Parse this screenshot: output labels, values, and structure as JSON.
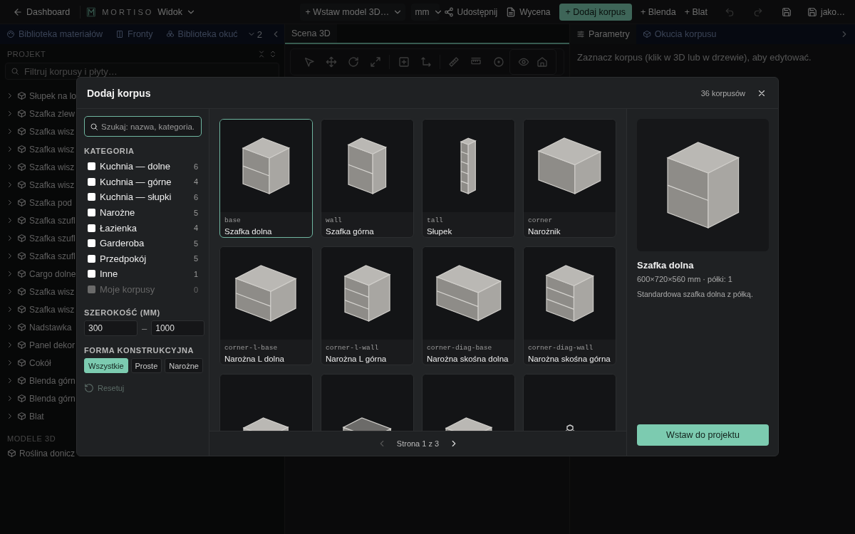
{
  "topbar": {
    "back": "Dashboard",
    "logo": "MORTISO",
    "view_menu": "Widok",
    "insert_model": "+ Wstaw model 3D…",
    "unit": "mm",
    "share": "Udostępnij",
    "quote": "Wycena",
    "add_cabinet": "+ Dodaj korpus",
    "add_blend": "+ Blenda",
    "add_top": "+ Blat",
    "save_as": "jako…"
  },
  "left_panel": {
    "tabs": [
      {
        "label": "Biblioteka materiałów",
        "selected": false
      },
      {
        "label": "Fronty",
        "selected": false
      },
      {
        "label": "Biblioteka okuć",
        "selected": false
      }
    ],
    "overflow": "2",
    "section": "PROJEKT",
    "filter": {
      "placeholder": "Filtruj korpusy i płyty…"
    },
    "tree": [
      {
        "label": "Słupek na lo",
        "expanded": false
      },
      {
        "label": "Szafka zlew",
        "expanded": false
      },
      {
        "label": "Szafka wisz",
        "expanded": false
      },
      {
        "label": "Szafka wisz",
        "expanded": false
      },
      {
        "label": "Szafka wisz",
        "expanded": false
      },
      {
        "label": "Szafka wisz",
        "expanded": false
      },
      {
        "label": "Szafka pod",
        "expanded": false
      },
      {
        "label": "Szafka szufl",
        "expanded": false
      },
      {
        "label": "Szafka szufl",
        "expanded": false
      },
      {
        "label": "Szafka szufl",
        "expanded": false
      },
      {
        "label": "Cargo dolne",
        "expanded": false
      },
      {
        "label": "Szafka wisz",
        "expanded": false
      },
      {
        "label": "Szafka wisz",
        "expanded": false
      },
      {
        "label": "Nadstawka",
        "expanded": false
      },
      {
        "label": "Panel dekor",
        "expanded": false
      },
      {
        "label": "Cokół",
        "expanded": false
      },
      {
        "label": "Blenda górn",
        "expanded": false
      },
      {
        "label": "Blenda górn",
        "expanded": false
      },
      {
        "label": "Blat",
        "expanded": false
      }
    ],
    "models_section": "MODELE 3D",
    "models": [
      {
        "label": "Roślina donicz"
      }
    ]
  },
  "center_panel": {
    "tabs": [
      {
        "label": "Scena 3D",
        "selected": true
      }
    ]
  },
  "right_panel": {
    "tabs": [
      {
        "label": "Parametry",
        "selected": true
      },
      {
        "label": "Okucia korpusu",
        "selected": false
      }
    ],
    "hint": "Zaznacz korpus (klik w 3D lub w drzewie), aby edytować."
  },
  "dialog": {
    "title": "Dodaj korpus",
    "count": "36 korpusów",
    "search": {
      "placeholder": "Szukaj: nazwa, kategoria."
    },
    "category_heading": "KATEGORIA",
    "categories": [
      {
        "label": "Kuchnia — dolne",
        "count": "6",
        "checked": false,
        "disabled": false
      },
      {
        "label": "Kuchnia — górne",
        "count": "4",
        "checked": false,
        "disabled": false
      },
      {
        "label": "Kuchnia — słupki",
        "count": "6",
        "checked": false,
        "disabled": false
      },
      {
        "label": "Narożne",
        "count": "5",
        "checked": false,
        "disabled": false
      },
      {
        "label": "Łazienka",
        "count": "4",
        "checked": false,
        "disabled": false
      },
      {
        "label": "Garderoba",
        "count": "5",
        "checked": false,
        "disabled": false
      },
      {
        "label": "Przedpokój",
        "count": "5",
        "checked": false,
        "disabled": false
      },
      {
        "label": "Inne",
        "count": "1",
        "checked": false,
        "disabled": false
      },
      {
        "label": "Moje korpusy",
        "count": "0",
        "checked": false,
        "disabled": true
      }
    ],
    "width_heading": "SZEROKOŚĆ (MM)",
    "width_min": "300",
    "width_separator": "–",
    "width_max": "1000",
    "form_heading": "FORMA KONSTRUKCYJNA",
    "forms": [
      {
        "label": "Wszystkie",
        "selected": true
      },
      {
        "label": "Proste",
        "selected": false
      },
      {
        "label": "Narożne",
        "selected": false
      }
    ],
    "reset": {
      "label": "Resetuj",
      "disabled": true
    },
    "cards": [
      {
        "kind": "box",
        "code": "base",
        "name": "Szafka dolna",
        "selected": true
      },
      {
        "kind": "wall",
        "code": "wall",
        "name": "Szafka górna",
        "selected": false
      },
      {
        "kind": "tall",
        "code": "tall",
        "name": "Słupek",
        "selected": false
      },
      {
        "kind": "wide",
        "code": "corner",
        "name": "Narożnik",
        "selected": false
      },
      {
        "kind": "lshape",
        "code": "corner-l-base",
        "name": "Narożna L dolna",
        "selected": false
      },
      {
        "kind": "ltall",
        "code": "corner-l-wall",
        "name": "Narożna L górna",
        "selected": false
      },
      {
        "kind": "diag",
        "code": "corner-diag-base",
        "name": "Narożna skośna dolna",
        "selected": false
      },
      {
        "kind": "diagtall",
        "code": "corner-diag-wall",
        "name": "Narożna skośna górna",
        "selected": false
      },
      {
        "kind": "drawers",
        "selected": false
      },
      {
        "kind": "sink",
        "selected": false
      },
      {
        "kind": "open",
        "selected": false
      },
      {
        "kind": "empty",
        "selected": false
      }
    ],
    "pagination": {
      "label": "Strona 1 z 3",
      "prev_disabled": true,
      "next_disabled": false
    },
    "preview": {
      "kind": "box",
      "name": "Szafka dolna",
      "specs": "600×720×560 mm · półki: 1",
      "description": "Standardowa szafka dolna z półką."
    },
    "insert": "Wstaw do projektu"
  }
}
